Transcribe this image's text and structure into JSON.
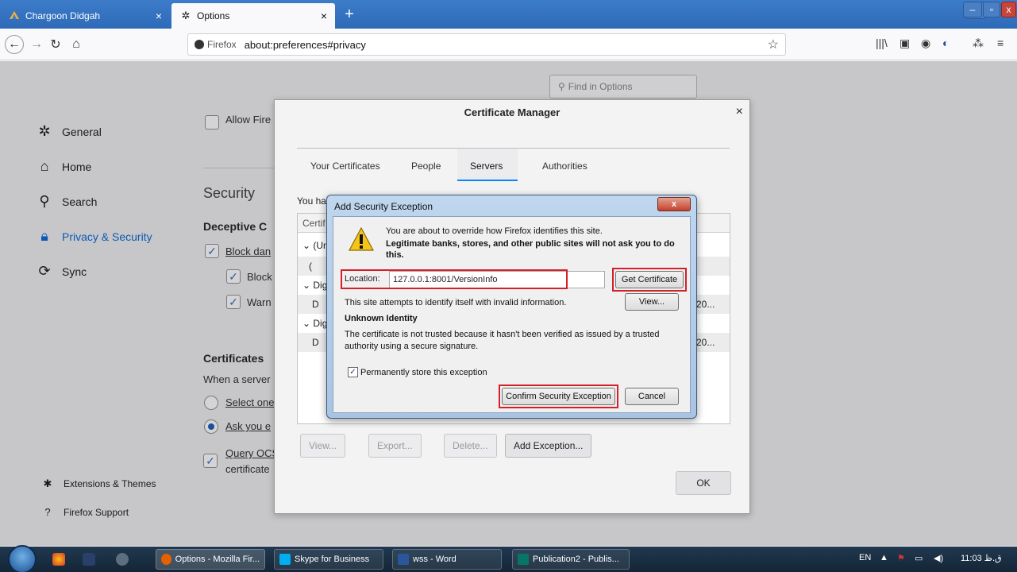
{
  "browser": {
    "tabs": [
      {
        "title": "Chargoon Didgah",
        "close": "×"
      },
      {
        "title": "Options",
        "close": "×"
      }
    ],
    "newtab": "+",
    "url_identity": "Firefox",
    "url": "about:preferences#privacy"
  },
  "page": {
    "find_placeholder": "Find in Options",
    "categories": [
      {
        "label": "General",
        "icon": "gear-icon"
      },
      {
        "label": "Home",
        "icon": "home-icon"
      },
      {
        "label": "Search",
        "icon": "search-icon"
      },
      {
        "label": "Privacy & Security",
        "icon": "lock-icon"
      },
      {
        "label": "Sync",
        "icon": "sync-icon"
      }
    ],
    "footer_links": [
      {
        "label": "Extensions & Themes",
        "icon": "puzzle-icon"
      },
      {
        "label": "Firefox Support",
        "icon": "help-icon"
      }
    ],
    "allow_text": "Allow Fire",
    "security_heading": "Security",
    "deceptive_heading": "Deceptive C",
    "block_dan": "Block dan",
    "block": "Block",
    "warn": "Warn",
    "certificates_heading": "Certificates",
    "when_server": "When a server",
    "select_one": "Select one",
    "ask_you": "Ask you e",
    "query_ocs": "Query OCS",
    "certificate": "certificate"
  },
  "cert_manager": {
    "title": "Certificate Manager",
    "close": "×",
    "tabs": [
      "Your Certificates",
      "People",
      "Servers",
      "Authorities"
    ],
    "selected_tab": "Servers",
    "intro": "You hav",
    "list_header": "Certif",
    "rows": [
      "(Unk",
      "(",
      "Dig",
      "D",
      "Dig",
      "D"
    ],
    "row_tail": [
      "20...",
      "20..."
    ],
    "buttons": [
      "View...",
      "Export...",
      "Delete...",
      "Add Exception..."
    ],
    "ok": "OK"
  },
  "add_exception": {
    "title": "Add Security Exception",
    "close": "x",
    "warn_line1": "You are about to override how Firefox identifies this site.",
    "warn_line2": "Legitimate banks, stores, and other public sites will not ask you to do",
    "warn_line3": "this.",
    "location_label": "Location:",
    "location_value": "127.0.0.1:8001/VersionInfo",
    "get_certificate": "Get Certificate",
    "invalid_info": "This site attempts to identify itself with invalid information.",
    "view": "View...",
    "unknown_identity": "Unknown Identity",
    "not_trusted_1": "The certificate is not trusted because it hasn't been verified as issued by a trusted",
    "not_trusted_2": "authority using a secure signature.",
    "permanent": "Permanently store this exception",
    "confirm": "Confirm Security Exception",
    "cancel": "Cancel",
    "highlight_color": "#d61f26"
  },
  "taskbar": {
    "items": [
      "Options - Mozilla Fir...",
      "Skype for Business",
      "wss - Word",
      "Publication2 - Publis..."
    ],
    "lang": "EN",
    "time": "11:03 ق.ظ"
  }
}
